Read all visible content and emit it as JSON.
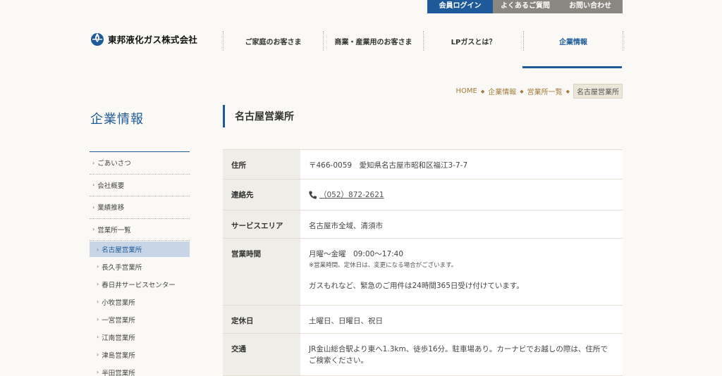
{
  "utility": {
    "login": "会員ログイン",
    "faq": "よくあるご質問",
    "contact": "お問い合わせ"
  },
  "logo": {
    "text": "東邦液化ガス株式会社"
  },
  "gnav": [
    {
      "label": "ご家庭のお客さま"
    },
    {
      "label": "商業・産業用のお客さま"
    },
    {
      "label": "LPガスとは？"
    },
    {
      "label": "企業情報"
    }
  ],
  "breadcrumb": {
    "items": [
      "HOME",
      "企業情報",
      "営業所一覧"
    ],
    "current": "名古屋営業所"
  },
  "sidebar": {
    "title": "企業情報",
    "menu": [
      "ごあいさつ",
      "会社概要",
      "業績推移",
      "営業所一覧"
    ],
    "sub": [
      "名古屋営業所",
      "長久手営業所",
      "春日井サービスセンター",
      "小牧営業所",
      "一宮営業所",
      "江南営業所",
      "津島営業所",
      "半田営業所"
    ]
  },
  "page": {
    "heading": "名古屋営業所"
  },
  "info": {
    "address_label": "住所",
    "address": "〒466-0059　愛知県名古屋市昭和区福江3-7-7",
    "contact_label": "連絡先",
    "phone": "（052）872-2621",
    "area_label": "サービスエリア",
    "area": "名古屋市全域、清須市",
    "hours_label": "営業時間",
    "hours": "月曜～金曜　09:00～17:40",
    "hours_note": "※営業時間、定休日は、変更になる場合がございます。",
    "hours_extra": "ガスもれなど、緊急のご用件は24時間365日受け付けています。",
    "holiday_label": "定休日",
    "holiday": "土曜日、日曜日、祝日",
    "access_label": "交通",
    "access": "JR金山総合駅より東へ1.3km、徒歩16分。駐車場あり。カーナビでお越しの際は、住所でご検索ください。"
  },
  "colors": {
    "brand": "#1e5a9a",
    "gray_button": "#8a8680",
    "breadcrumb_link": "#a37a3a",
    "active_bg": "#c8d5e6"
  }
}
